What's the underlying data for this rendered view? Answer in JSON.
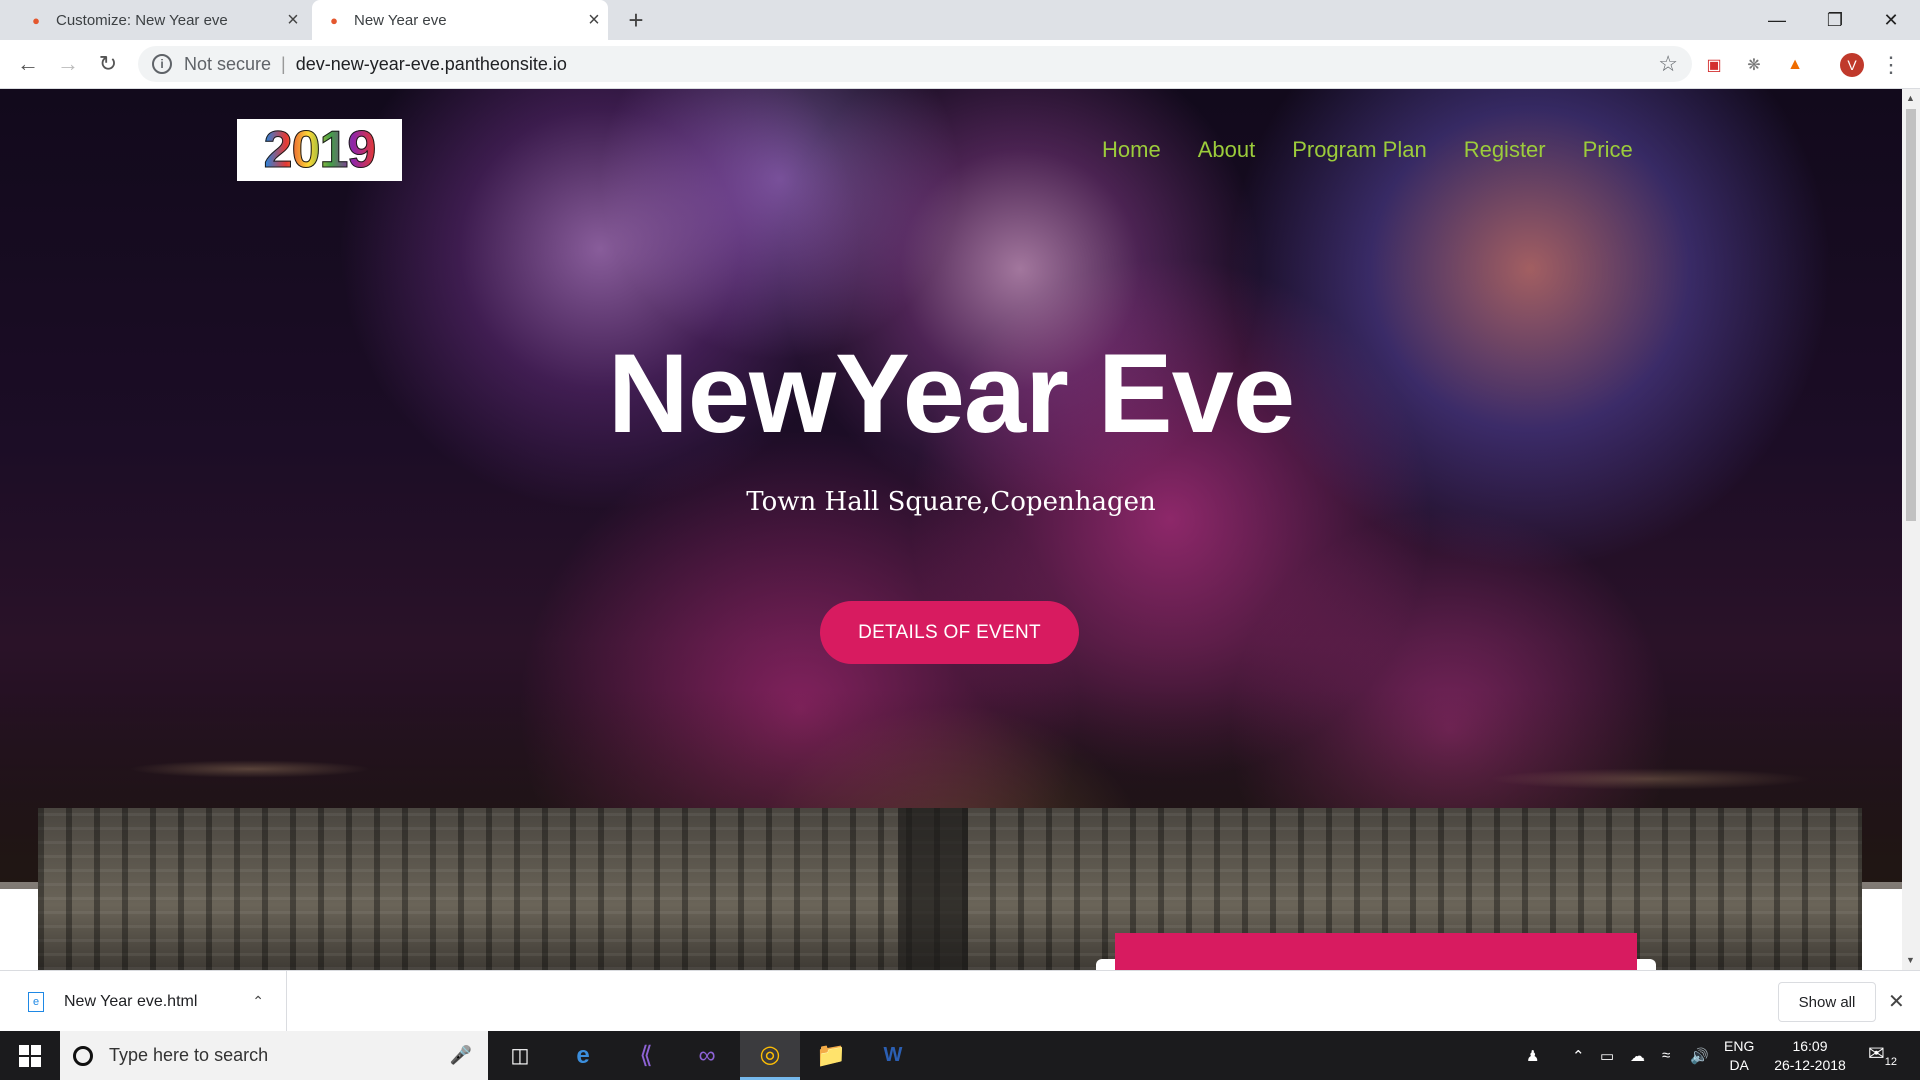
{
  "browser": {
    "tabs": [
      {
        "title": "Customize: New Year eve",
        "active": false
      },
      {
        "title": "New Year eve",
        "active": true
      }
    ],
    "address": {
      "security": "Not secure",
      "url": "dev-new-year-eve.pantheonsite.io"
    },
    "profile_initial": "V"
  },
  "page": {
    "logo_text": "2019",
    "nav": [
      "Home",
      "About",
      "Program Plan",
      "Register",
      "Price"
    ],
    "hero_title": "NewYear Eve",
    "hero_subtitle": "Town Hall Square,Copenhagen",
    "hero_button": "DETAILS OF EVENT",
    "accent_color": "#d81b60",
    "nav_color": "#9ccc3b"
  },
  "downloads": {
    "file_name": "New Year eve.html",
    "show_all": "Show all"
  },
  "taskbar": {
    "search_placeholder": "Type here to search",
    "lang_top": "ENG",
    "lang_bottom": "DA",
    "time": "16:09",
    "date": "26-12-2018",
    "notification_count": "12",
    "pinned": [
      "task-view-icon",
      "edge-icon",
      "visual-studio-code-icon",
      "visual-studio-icon",
      "chrome-icon",
      "file-explorer-icon",
      "word-icon"
    ]
  }
}
